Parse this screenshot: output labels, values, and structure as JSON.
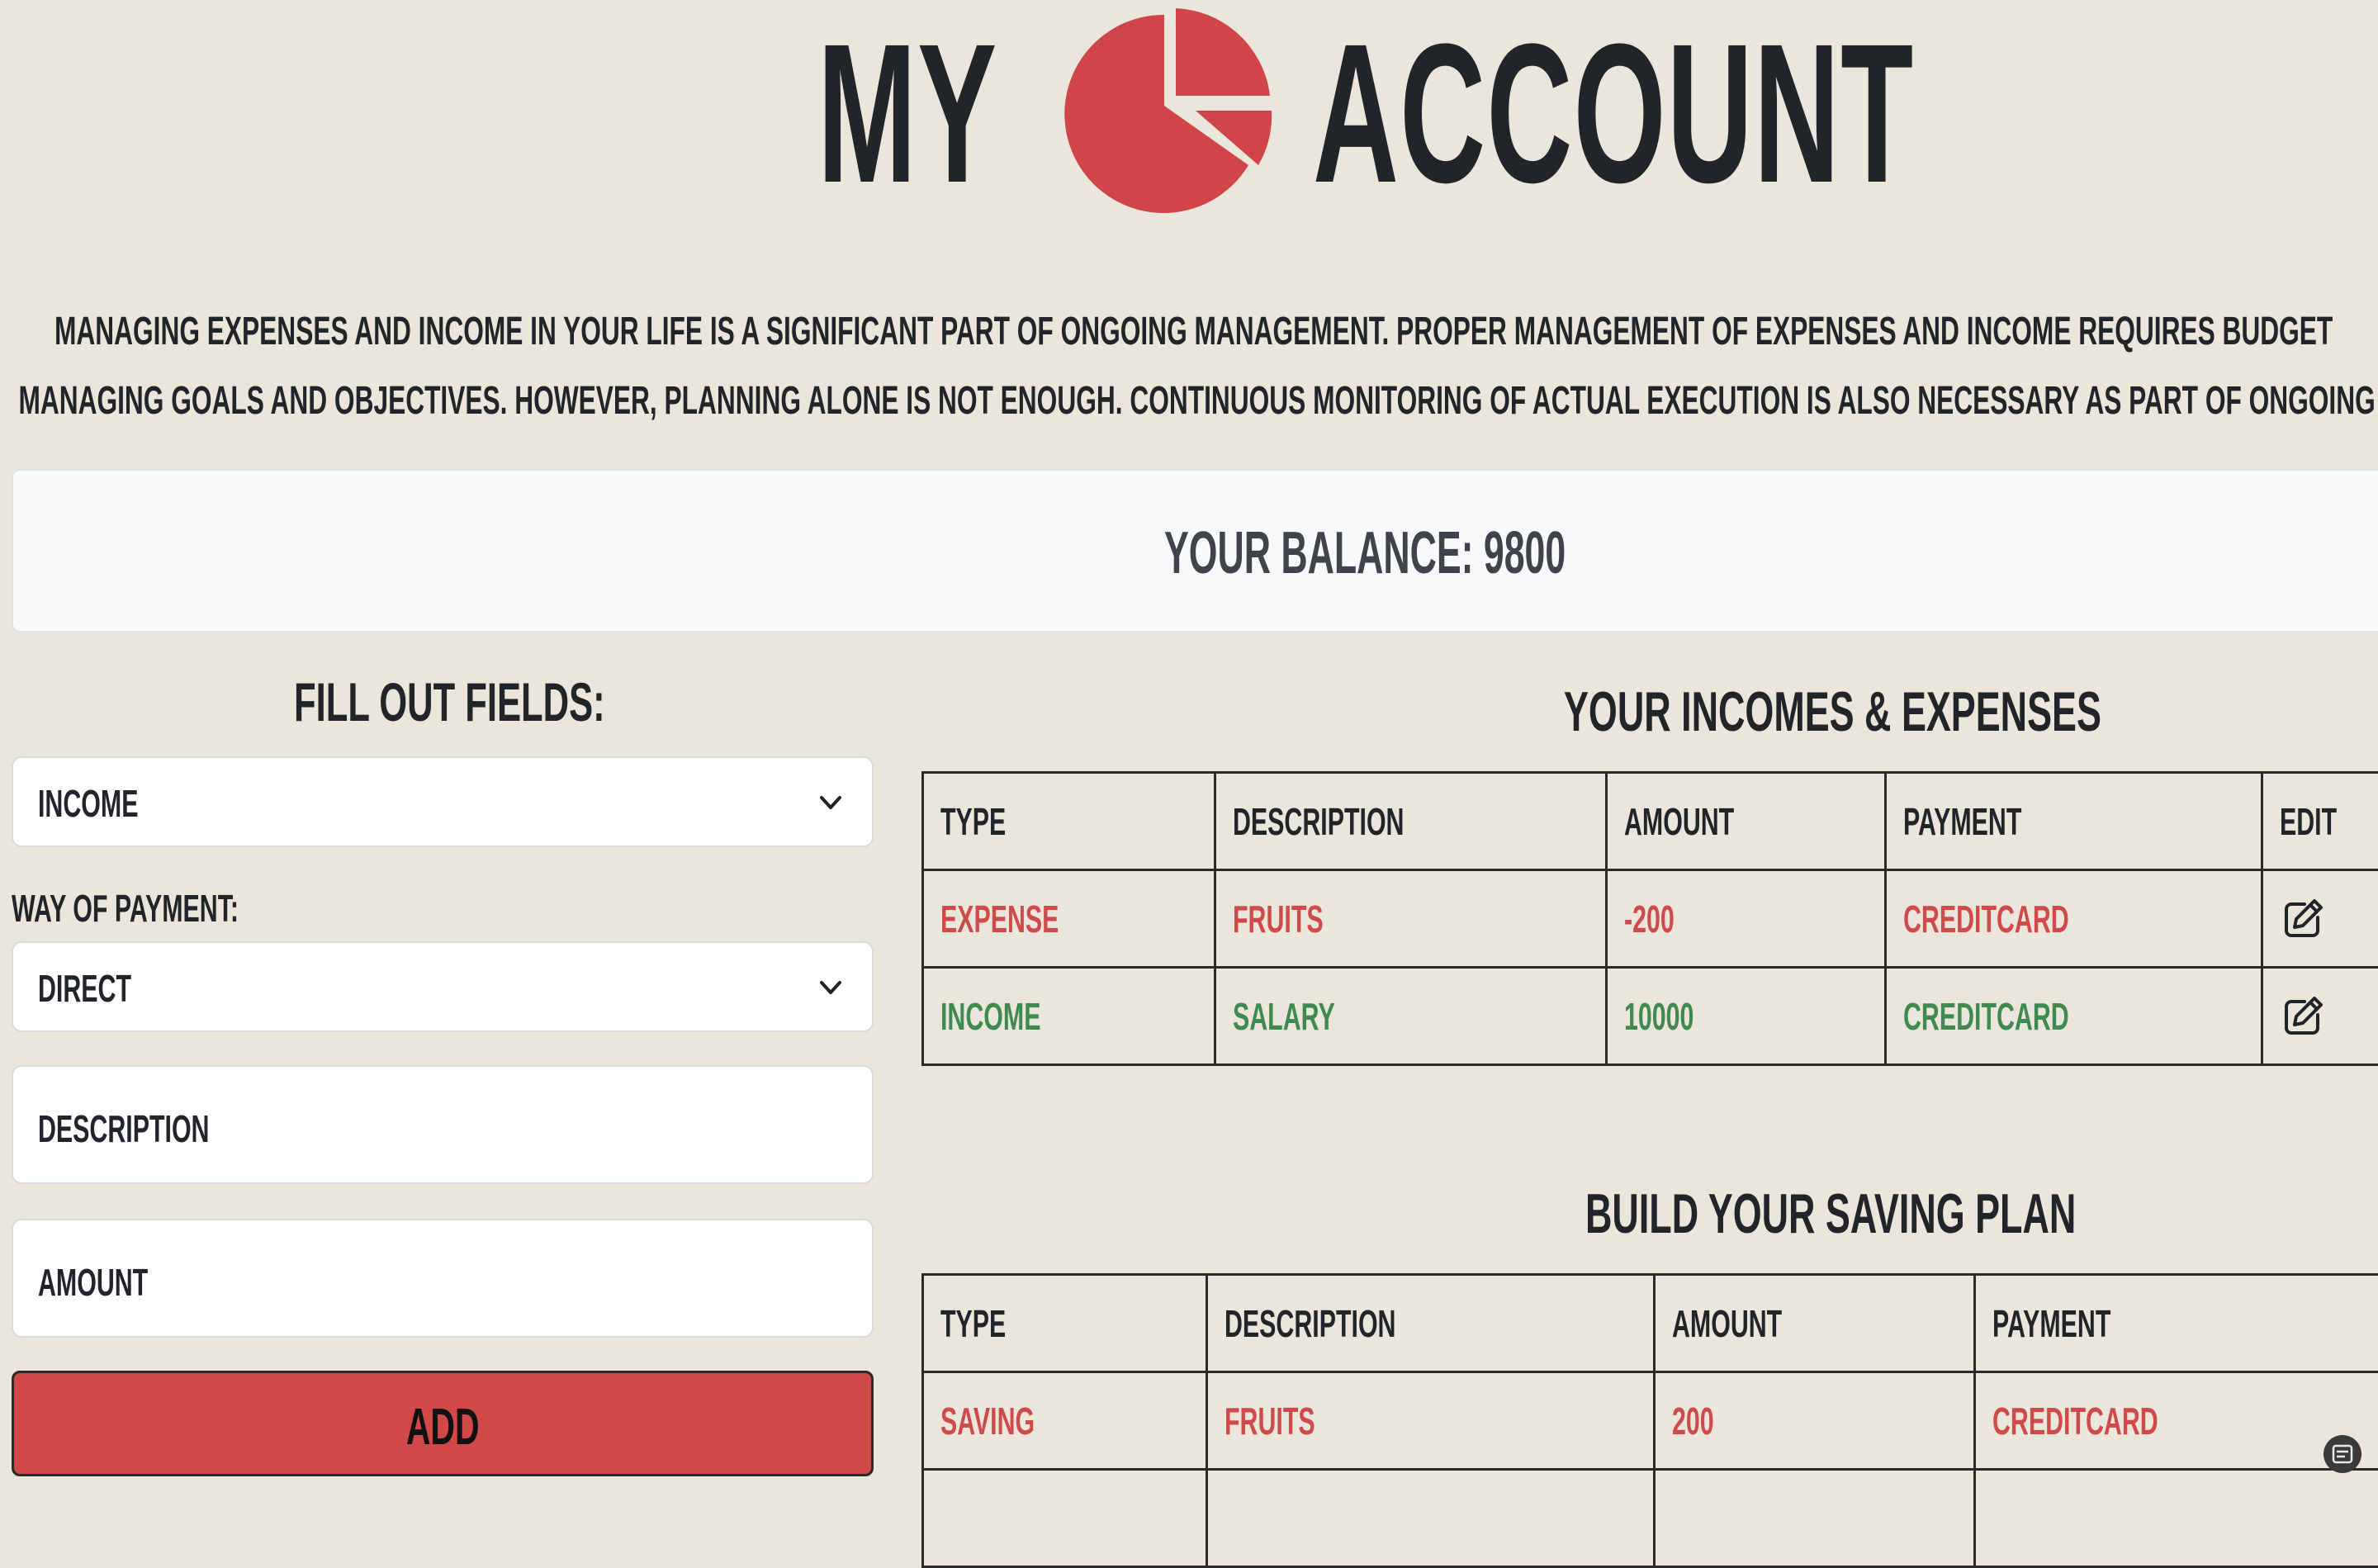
{
  "header": {
    "title_left": "MY",
    "title_right": "ACCOUNT",
    "logo_icon": "pie-chart-icon",
    "logo_color": "#d04549"
  },
  "intro": {
    "line1": "Managing expenses and income in your life is a significant part of ongoing management. Proper management of expenses and income requires budget",
    "line2": "managing goals and objectives. However, planning alone is not enough. Continuous monitoring of actual execution is also necessary as part of ongoing"
  },
  "balance": {
    "text": "YOUR BALANCE: 9800"
  },
  "form": {
    "title": "FILL OUT FIELDS:",
    "type_select_value": "INCOME",
    "payment_label": "WAY OF PAYMENT:",
    "payment_select_value": "DIRECT",
    "description_placeholder": "DESCRIPTION",
    "amount_placeholder": "AMOUNT",
    "add_label": "ADD",
    "add_color": "#d04848"
  },
  "transactions": {
    "title": "YOUR INCOMES & EXPENSES",
    "headers": [
      "TYPE",
      "DESCRIPTION",
      "AMOUNT",
      "PAYMENT",
      "EDIT"
    ],
    "rows": [
      {
        "type": "EXPENSE",
        "description": "FRUITS",
        "amount": "-200",
        "payment": "CREDITCARD",
        "edit_icon": "edit-icon"
      },
      {
        "type": "INCOME",
        "description": "SALARY",
        "amount": "10000",
        "payment": "CREDITCARD",
        "edit_icon": "edit-icon"
      }
    ],
    "expense_color": "#cf4a4a",
    "income_color": "#3f8a50"
  },
  "savings": {
    "title": "BUILD YOUR SAVING PLAN",
    "headers": [
      "TYPE",
      "DESCRIPTION",
      "AMOUNT",
      "PAYMENT"
    ],
    "rows": [
      {
        "type": "SAVING",
        "description": "FRUITS",
        "amount": "200",
        "payment": "CREDITCARD"
      }
    ]
  }
}
